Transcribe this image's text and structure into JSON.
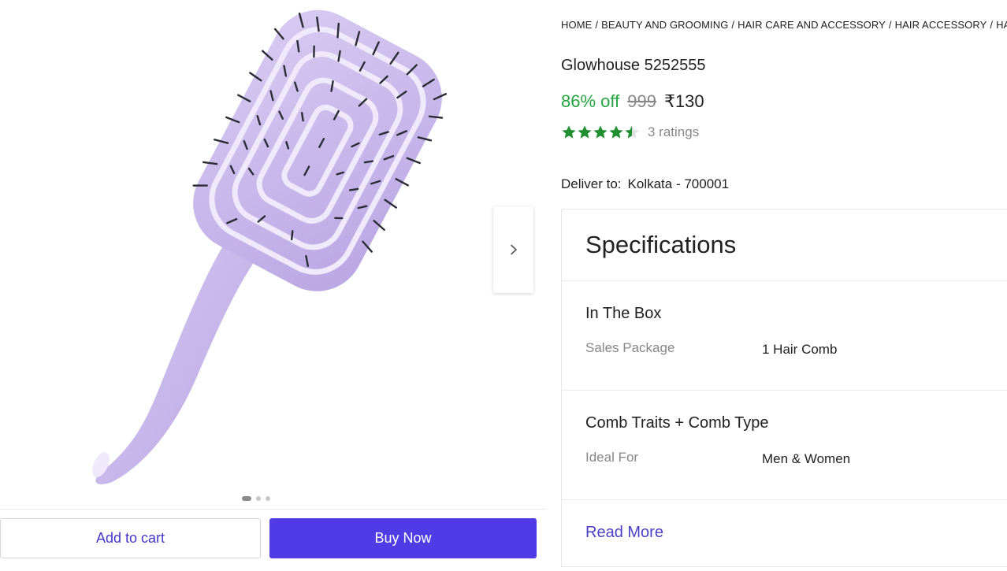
{
  "breadcrumb": [
    "HOME",
    "BEAUTY AND GROOMING",
    "HAIR CARE AND ACCESSORY",
    "HAIR ACCESSORY",
    "HAIR CO"
  ],
  "product": {
    "title": "Glowhouse 5252555",
    "discount": "86% off",
    "mrp": "999",
    "price": "₹130",
    "rating_value": 4.5,
    "ratings_count": "3 ratings"
  },
  "delivery": {
    "label": "Deliver to:",
    "location": "Kolkata - 700001"
  },
  "carousel": {
    "slides": 3,
    "active": 0
  },
  "actions": {
    "add_to_cart": "Add to cart",
    "buy_now": "Buy Now"
  },
  "specifications": {
    "title": "Specifications",
    "groups": [
      {
        "title": "In The Box",
        "rows": [
          {
            "key": "Sales Package",
            "value": "1 Hair Comb"
          }
        ]
      },
      {
        "title": "Comb Traits + Comb Type",
        "rows": [
          {
            "key": "Ideal For",
            "value": "Men & Women"
          }
        ]
      }
    ],
    "read_more": "Read More"
  },
  "colors": {
    "discount_green": "#26a541",
    "star_green": "#1f8f2f",
    "buy_button": "#4f3ce6",
    "link_purple": "#4b3fc6",
    "product_lavender": "#c9b8ea"
  }
}
